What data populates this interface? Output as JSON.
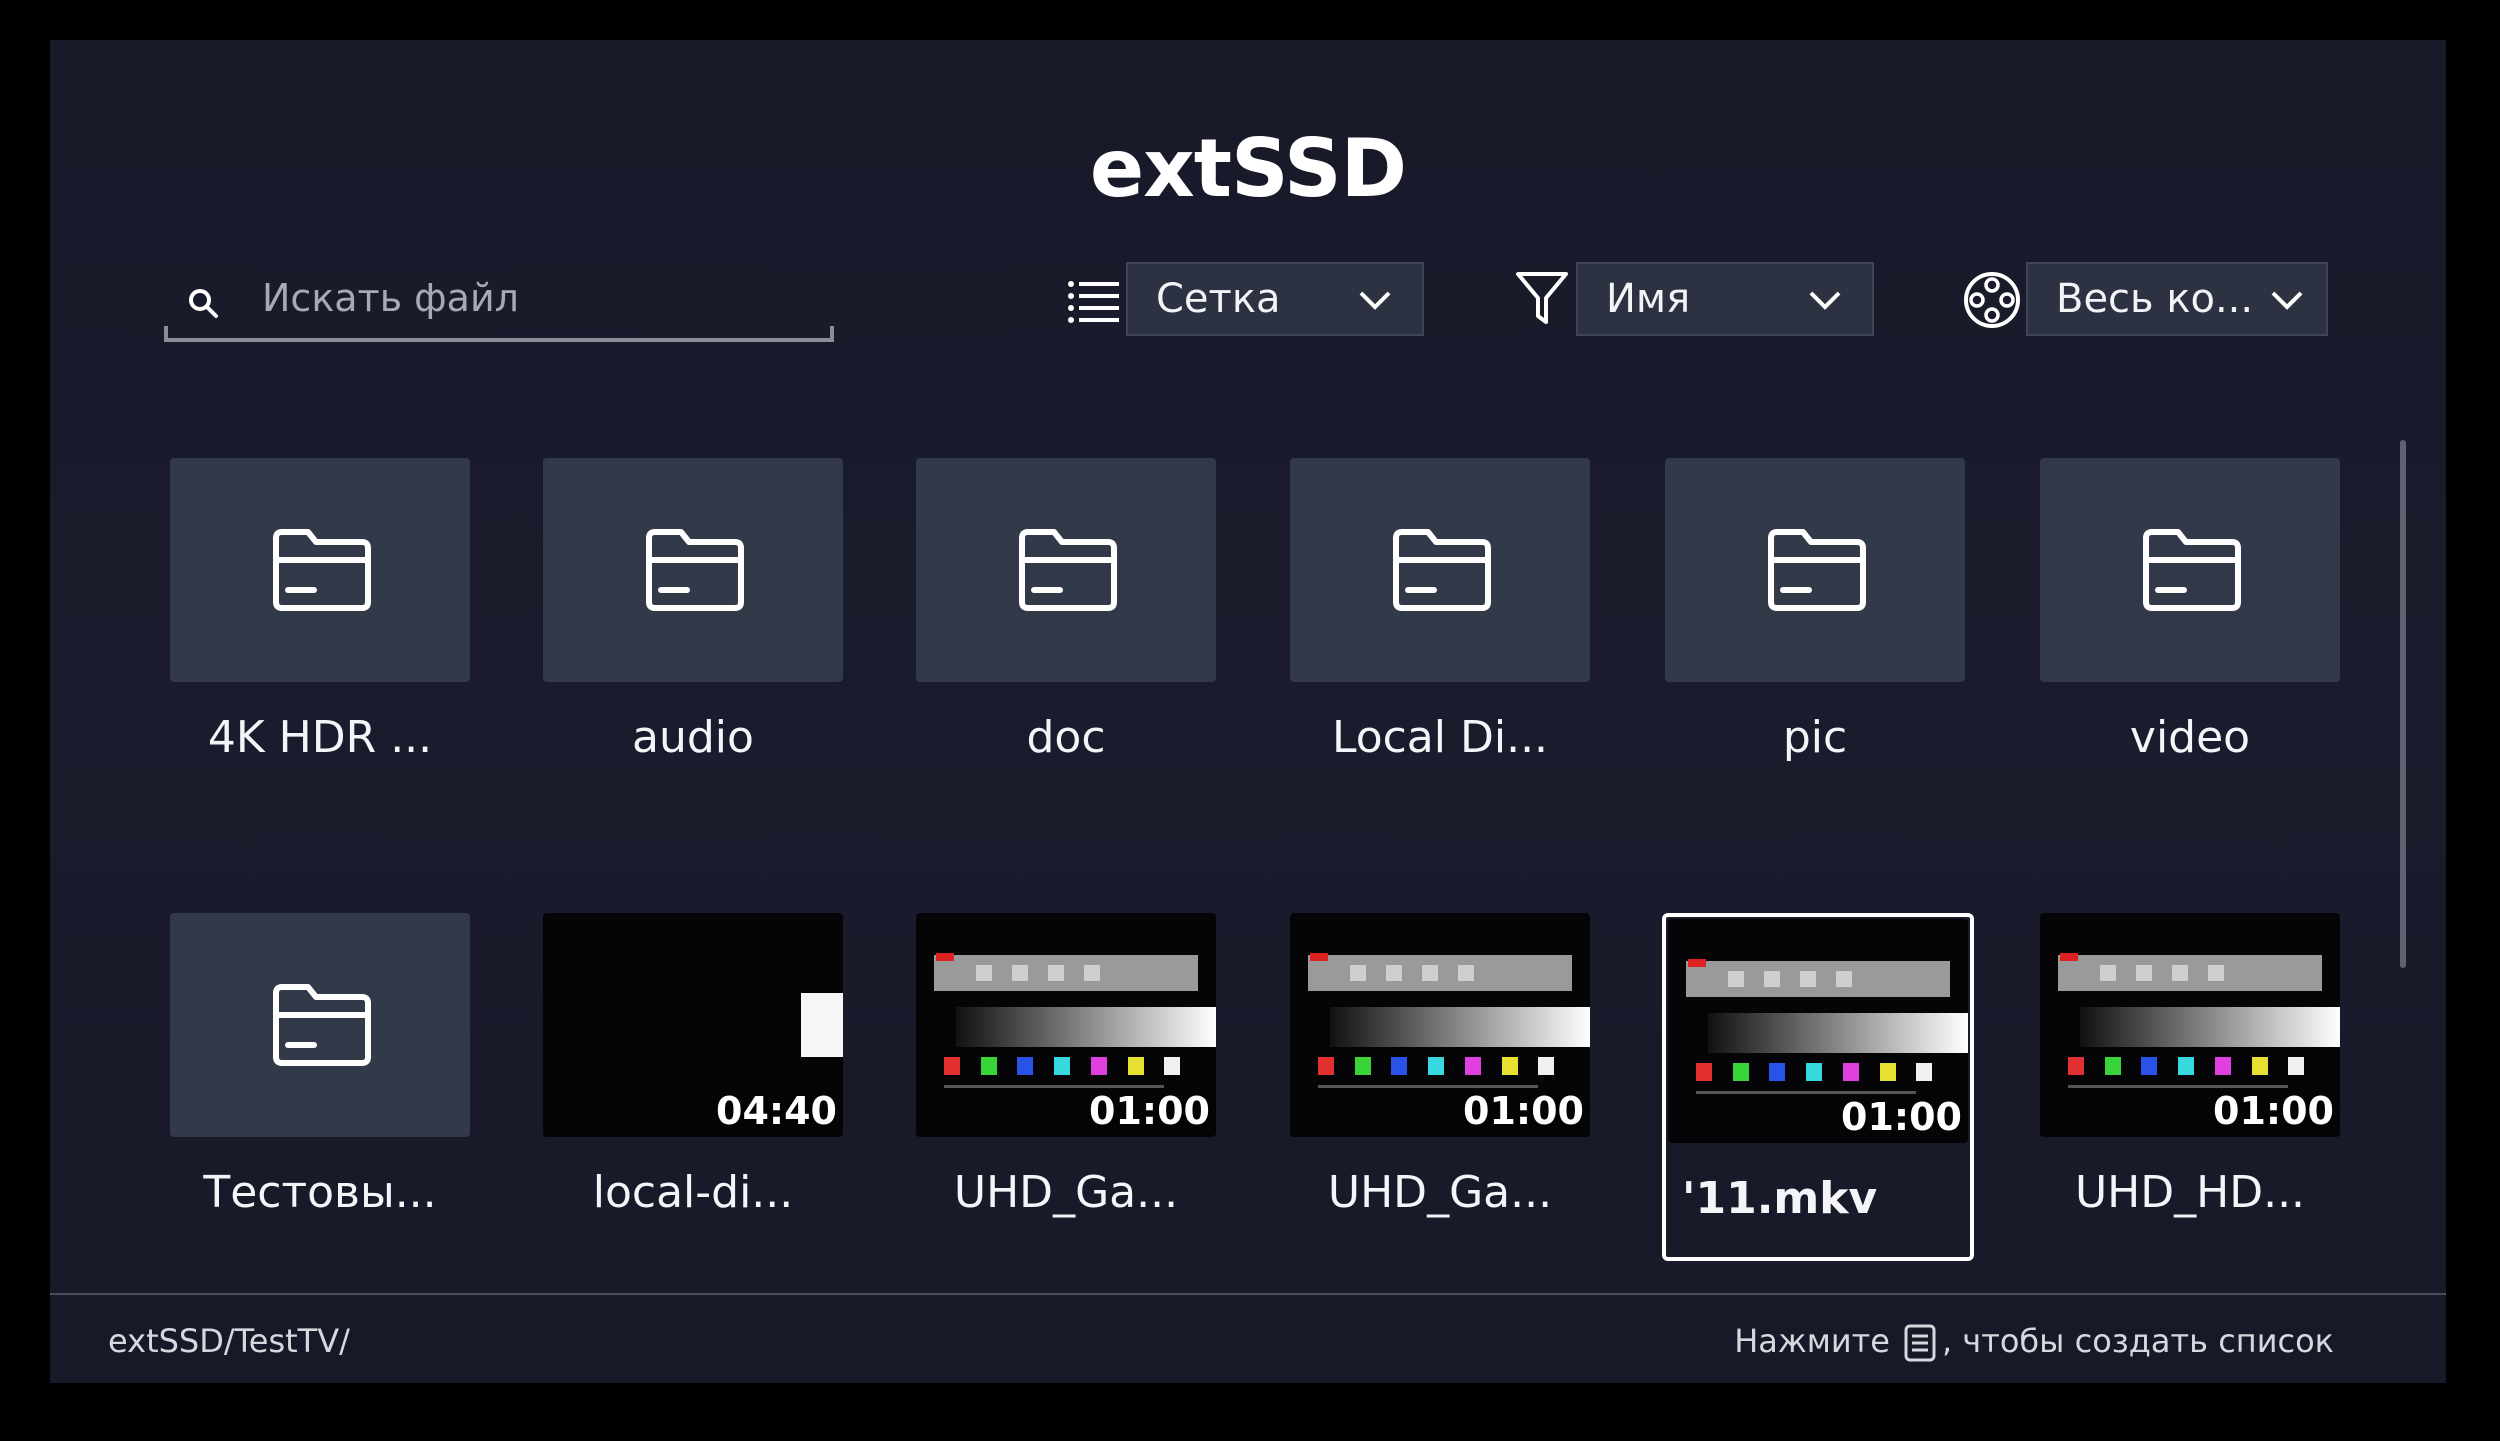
{
  "title": "extSSD",
  "search": {
    "placeholder": "Искать файл"
  },
  "view_dropdown": {
    "label": "Сетка"
  },
  "sort_dropdown": {
    "label": "Имя"
  },
  "content_dropdown": {
    "label": "Весь ко..."
  },
  "items": [
    {
      "name": "4K HDR ...",
      "type": "folder"
    },
    {
      "name": "audio",
      "type": "folder"
    },
    {
      "name": "doc",
      "type": "folder"
    },
    {
      "name": "Local Di...",
      "type": "folder"
    },
    {
      "name": "pic",
      "type": "folder"
    },
    {
      "name": "video",
      "type": "folder"
    },
    {
      "name": "Тестовы...",
      "type": "folder"
    },
    {
      "name": "local-di...",
      "type": "video",
      "duration": "04:40"
    },
    {
      "name": "UHD_Ga...",
      "type": "video",
      "duration": "01:00"
    },
    {
      "name": "UHD_Ga...",
      "type": "video",
      "duration": "01:00"
    },
    {
      "name": "'11.mkv",
      "type": "video",
      "duration": "01:00",
      "selected": true
    },
    {
      "name": "UHD_HD...",
      "type": "video",
      "duration": "01:00"
    }
  ],
  "footer": {
    "path": "extSSD/TestTV/",
    "hint_before": "Нажмите",
    "hint_after": ", чтобы создать список"
  }
}
